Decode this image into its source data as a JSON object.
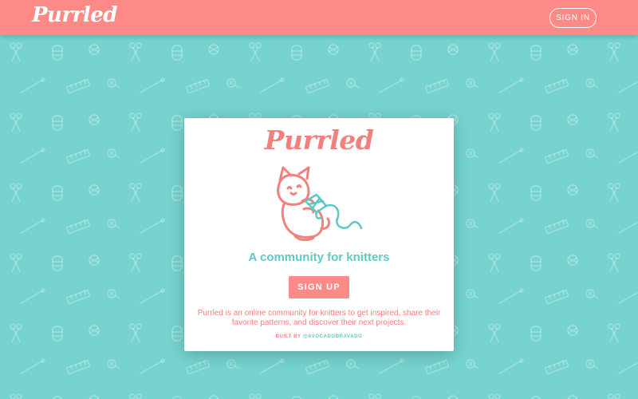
{
  "header": {
    "brand": "Purrled",
    "sign_in_label": "SIGN IN"
  },
  "card": {
    "brand": "Purrled",
    "mascot_icon": "cat-with-yarn-icon",
    "tagline": "A community for knitters",
    "sign_up_label": "SIGN UP",
    "description": "Purrled is an online community for knitters to get inspired, share their favorite patterns, and discover their next projects.",
    "credit_prefix": "BUILT BY",
    "credit_handle": "@AVOCADOBRAVADO"
  },
  "background": {
    "pattern_icons": [
      "scissors-icon",
      "yarn-ball-icon",
      "knitting-needle-icon",
      "ruler-icon",
      "tape-measure-icon",
      "yarn-skein-icon"
    ]
  },
  "colors": {
    "teal": "#76d3cf",
    "coral": "#fd8a87",
    "white": "#ffffff"
  }
}
